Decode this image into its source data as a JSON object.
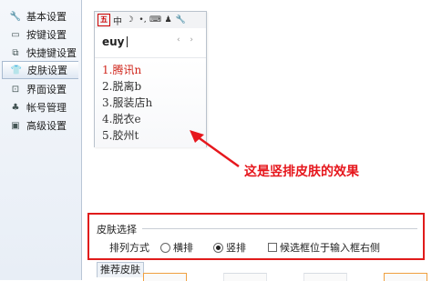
{
  "sidebar": {
    "items": [
      {
        "label": "基本设置",
        "icon": "wrench-icon",
        "glyph": "🔧"
      },
      {
        "label": "按键设置",
        "icon": "keyboard-icon",
        "glyph": "▭"
      },
      {
        "label": "快捷键设置",
        "icon": "shortcut-icon",
        "glyph": "⧉"
      },
      {
        "label": "皮肤设置",
        "icon": "tshirt-icon",
        "glyph": "👕",
        "active": true
      },
      {
        "label": "界面设置",
        "icon": "window-icon",
        "glyph": "⊡"
      },
      {
        "label": "帐号管理",
        "icon": "user-icon",
        "glyph": "♣"
      },
      {
        "label": "高级设置",
        "icon": "advanced-icon",
        "glyph": "▣"
      }
    ]
  },
  "preview": {
    "toolbar": {
      "logo": "五",
      "lang": "中",
      "moon": "☽",
      "punct": "•,",
      "keyboard": "⌨",
      "user": "♟",
      "tool": "🔧"
    },
    "pinyin": "euy",
    "pager": "‹ ›",
    "candidates": [
      "1.腾讯n",
      "2.脱离b",
      "3.服装店h",
      "4.脱衣e",
      "5.胶州t"
    ]
  },
  "annotation": {
    "text": "这是竖排皮肤的效果",
    "color": "#e6171d"
  },
  "skin_panel": {
    "title": "皮肤选择",
    "layout_label": "排列方式",
    "options": [
      {
        "label": "横排",
        "selected": false
      },
      {
        "label": "竖排",
        "selected": true
      }
    ],
    "checkbox": {
      "label": "候选框位于输入框右侧",
      "checked": false
    }
  },
  "recommended_tab": "推荐皮肤",
  "colors": {
    "highlight_border": "#e01b1b",
    "first_candidate": "#d0261c"
  }
}
